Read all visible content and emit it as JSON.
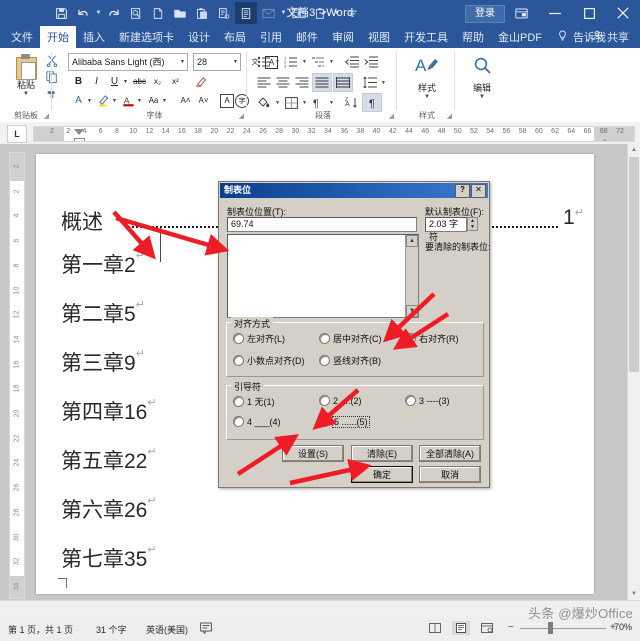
{
  "titlebar": {
    "document_title": "文档3 - Word",
    "signin_label": "登录",
    "quick_access": [
      {
        "name": "save-icon",
        "glyph": "save"
      },
      {
        "name": "undo-icon",
        "glyph": "undo"
      },
      {
        "name": "redo-icon",
        "glyph": "redo"
      },
      {
        "name": "print-preview-icon",
        "glyph": "preview"
      },
      {
        "name": "new-document-icon",
        "glyph": "new"
      },
      {
        "name": "open-folder-icon",
        "glyph": "open"
      },
      {
        "name": "paste-icon",
        "glyph": "paste"
      },
      {
        "name": "quick-print-icon",
        "glyph": "quickprint"
      },
      {
        "name": "read-mode-icon",
        "glyph": "readmode"
      },
      {
        "name": "email-icon",
        "glyph": "email"
      },
      {
        "name": "two-page-icon",
        "glyph": "twopage"
      },
      {
        "name": "format-painter-icon",
        "glyph": "painter"
      },
      {
        "name": "customize-toolbar-icon",
        "glyph": "more"
      }
    ],
    "window_buttons": [
      {
        "name": "ribbon-display-options",
        "glyph": "▣"
      },
      {
        "name": "minimize-button",
        "glyph": "—"
      },
      {
        "name": "maximize-button",
        "glyph": "☐"
      },
      {
        "name": "close-button",
        "glyph": "✕"
      }
    ]
  },
  "ribbon_tabs": {
    "left": [
      "文件",
      "开始",
      "插入",
      "新建选项卡",
      "设计",
      "布局",
      "引用",
      "邮件",
      "审阅",
      "视图",
      "开发工具",
      "帮助",
      "金山PDF"
    ],
    "active": "开始",
    "tell_me": "告诉我",
    "share": "共享"
  },
  "ribbon": {
    "groups": [
      {
        "name": "clipboard",
        "label": "剪贴板"
      },
      {
        "name": "font",
        "label": "字体"
      },
      {
        "name": "paragraph",
        "label": "段落"
      },
      {
        "name": "styles",
        "label": "样式"
      },
      {
        "name": "editing",
        "label": "编辑"
      }
    ],
    "paste_label": "粘贴",
    "font_name": "Alibaba Sans Light (西)",
    "font_size": "28",
    "styles_label": "样式",
    "editing_label": "编辑"
  },
  "ruler": {
    "corner_tab_marker": "L",
    "h_ticks": [
      "2",
      "2",
      "4",
      "6",
      "8",
      "10",
      "12",
      "14",
      "16",
      "18",
      "20",
      "22",
      "24",
      "26",
      "28",
      "30",
      "32",
      "34",
      "36",
      "38",
      "40",
      "42",
      "44",
      "46",
      "48",
      "50",
      "52",
      "54",
      "56",
      "58",
      "60",
      "62",
      "64",
      "66",
      "68",
      "72"
    ],
    "v_ticks": [
      "2",
      "2",
      "4",
      "6",
      "8",
      "10",
      "12",
      "14",
      "16",
      "18",
      "20",
      "22",
      "24",
      "26",
      "28",
      "30",
      "32",
      "34"
    ]
  },
  "document": {
    "lines": [
      {
        "text": "概述",
        "leader": true,
        "page": "1",
        "pilcrow": "↵"
      },
      {
        "text": "第一章2",
        "leader": false,
        "pilcrow": "↵"
      },
      {
        "text": "第二章5",
        "leader": false,
        "pilcrow": "↵"
      },
      {
        "text": "第三章9",
        "leader": false,
        "pilcrow": "↵"
      },
      {
        "text": "第四章16",
        "leader": false,
        "pilcrow": "↵"
      },
      {
        "text": "第五章22",
        "leader": false,
        "pilcrow": "↵"
      },
      {
        "text": "第六章26",
        "leader": false,
        "pilcrow": "↵"
      },
      {
        "text": "第七章35",
        "leader": false,
        "pilcrow": "↵"
      }
    ]
  },
  "dialog": {
    "title": "制表位",
    "help_button": "?",
    "close_button": "✕",
    "tab_position_label": "制表位位置(T):",
    "tab_position_value": "69.74",
    "default_tab_label": "默认制表位(F):",
    "default_tab_value": "2.03 字符",
    "to_clear_label": "要清除的制表位:",
    "alignment": {
      "legend": "对齐方式",
      "options": [
        {
          "label": "左对齐(L)",
          "selected": false
        },
        {
          "label": "居中对齐(C)",
          "selected": false
        },
        {
          "label": "右对齐(R)",
          "selected": true
        },
        {
          "label": "小数点对齐(D)",
          "selected": false
        },
        {
          "label": "竖线对齐(B)",
          "selected": false
        }
      ]
    },
    "leader": {
      "legend": "引导符",
      "options": [
        {
          "label": "1 无(1)",
          "selected": false
        },
        {
          "label": "2 ....(2)",
          "selected": false
        },
        {
          "label": "3 ----(3)",
          "selected": false
        },
        {
          "label": "4 ___(4)",
          "selected": false
        },
        {
          "label": "5 ......(5)",
          "selected": true
        }
      ]
    },
    "buttons": {
      "set": "设置(S)",
      "clear": "清除(E)",
      "clear_all": "全部清除(A)",
      "ok": "确定",
      "cancel": "取消"
    }
  },
  "statusbar": {
    "page_info": "第 1 页，共 1 页",
    "word_count": "31 个字",
    "language": "英语(美国)",
    "proofing_icon": "proofing-errors-icon",
    "views": [
      {
        "name": "read-mode-view",
        "glyph": "▤",
        "active": false
      },
      {
        "name": "print-layout-view",
        "glyph": "▥",
        "active": true
      },
      {
        "name": "web-layout-view",
        "glyph": "▦",
        "active": false
      }
    ],
    "zoom_out": "−",
    "zoom_in": "+",
    "zoom_level": "70%",
    "watermark": "头条 @爆炒Office"
  },
  "colors": {
    "word_blue": "#2b579a",
    "dialog_face": "#d4d0c8",
    "dialog_title_blue": "#0b3f8c",
    "arrow_red": "#ee1c25",
    "canvas_gray": "#c8c8c8"
  }
}
